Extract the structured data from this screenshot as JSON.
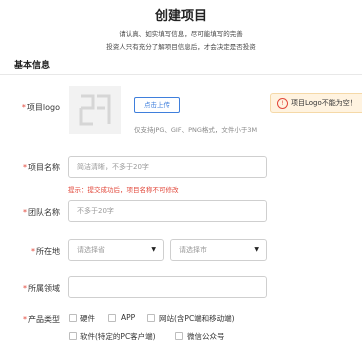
{
  "page": {
    "title": "创建项目",
    "intro_line1": "请认真、如实填写信息，尽可能填写的完善",
    "intro_line2": "投资人只有充分了解项目信息后，才会决定是否投资"
  },
  "section": {
    "title": "基本信息"
  },
  "required_mark": "*",
  "logo": {
    "label": "项目logo",
    "upload_button": "点击上传",
    "hint": "仅支持JPG、GIF、PNG格式，文件小于3M",
    "alert_text": "项目Logo不能为空！"
  },
  "project_name": {
    "label": "项目名称",
    "placeholder": "简洁清晰，不多于20字",
    "warning": "提示：提交成功后，项目名称不可修改"
  },
  "team_name": {
    "label": "团队名称",
    "placeholder": "不多于20字"
  },
  "location": {
    "label": "所在地",
    "province_placeholder": "请选择省",
    "city_placeholder": "请选择市"
  },
  "field": {
    "label": "所属领域",
    "value": ""
  },
  "product_type": {
    "label": "产品类型",
    "options": [
      "硬件",
      "APP",
      "网站(含PC端和移动端)",
      "软件(特定的PC客户端)",
      "微信公众号"
    ]
  },
  "icons": {
    "logo_placeholder": "logo-placeholder-icon",
    "caret": "caret-down-icon",
    "alert": "alert-circle-icon"
  },
  "colors": {
    "required": "#e2483b",
    "accent": "#3f7fdc",
    "alert_bg": "#fff3e0"
  }
}
